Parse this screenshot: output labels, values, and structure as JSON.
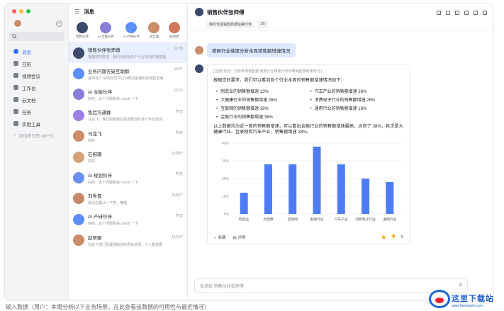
{
  "sidebar": {
    "search_icon": "search-icon",
    "items": [
      {
        "label": "消息",
        "active": true
      },
      {
        "label": "日历",
        "active": false
      },
      {
        "label": "视频会议",
        "active": false
      },
      {
        "label": "工作台",
        "active": false
      },
      {
        "label": "云文档",
        "active": false
      },
      {
        "label": "任务",
        "active": false
      },
      {
        "label": "实用工具",
        "active": false
      }
    ],
    "add_tab": "添加新页签 (⌘+T)"
  },
  "list": {
    "title": "消息",
    "ai_assistants": [
      {
        "label": "销售伙伴",
        "color": "#3b4a6b"
      },
      {
        "label": "AI 全能伙伴",
        "color": "#8a7fd8"
      },
      {
        "label": "AI 产研伙伴",
        "color": "#5b8ff9"
      },
      {
        "label": "赵云霞",
        "color": "#c98d6a"
      },
      {
        "label": "赵雨霏",
        "color": "#d07a5a"
      }
    ],
    "conversations": [
      {
        "name": "销售伙伴张师傅",
        "preview": "根据您的要求，我们对现有的个行业本周的销售额",
        "time": "10:35",
        "color": "#3b4a6b",
        "selected": true
      },
      {
        "name": "业务问题答疑互助群",
        "preview": "@所有人 请问你们可以对照这些组织的销售前端",
        "time": "10:21",
        "color": "#5b8ff9",
        "selected": false
      },
      {
        "name": "AI 全能伙伴",
        "preview": "好的，这个问题我来 check 一下",
        "time": "10:16",
        "color": "#8a7fd8",
        "selected": false
      },
      {
        "name": "售后沟通群",
        "preview": "马龙飞：我们的数据还是需要及时进行专业培训...",
        "time": "昨天",
        "color": "#9d7fe6",
        "selected": false
      },
      {
        "name": "马龙飞",
        "preview": "好的",
        "time": "昨天",
        "color": "#c98d6a",
        "selected": false
      },
      {
        "name": "石婉珊",
        "preview": "好的",
        "time": "10月27",
        "color": "#d6a079",
        "selected": false
      },
      {
        "name": "AI 规划伙伴",
        "preview": "好的，这个问题我来 check 一下",
        "time": "昨天",
        "color": "#6a8ff0",
        "selected": false
      },
      {
        "name": "刘秀晋",
        "preview": "我这边确认一下吧，哦哦",
        "time": "10月27",
        "color": "#c48a6c",
        "selected": false
      },
      {
        "name": "AI 产研伙伴",
        "preview": "好的，这个问题我来 check 一下",
        "time": "昨天",
        "color": "#5b8ff9",
        "selected": false
      },
      {
        "name": "赵翠娜",
        "preview": "在这个部门经理通知他的项目进展，个人帮进展",
        "time": "10月27",
        "color": "#c98d6a",
        "selected": false
      }
    ]
  },
  "chat": {
    "title": "销售伙伴张师傅",
    "chips": [
      "我的专属销售数据监察伙伴",
      "1/5"
    ],
    "user_message": "按照行业维度分析本周销售额增速情况",
    "reply": {
      "source": "[ 回复 张旭：分析本周销售额 按照行业维度分析本周销售额增速情况 ]",
      "intro": "根据您的要求，我们可以看到各个行业本周的销售额增速情况如下：",
      "bullets": [
        "制造业的销售额增速 13%",
        "汽车产业的销售额增速 28%",
        "大健康行业的销售额增速 26%",
        "消费电子行业的销售额增速 26%",
        "互联网的销售额增速 28%",
        "通用行业的销售额增速 18%",
        "金融行业的销售额增速 38%"
      ],
      "summary": "以上数据均为近一周的销售额增速，可以看出金融行业的销售额增速最高，达到了 38%，其次是大健康行业、互联网和汽车产业，销售额增速 28%。",
      "actions": {
        "like": "收藏",
        "detail": "详情"
      }
    },
    "input_placeholder": "发送给 销售伙伴张师傅"
  },
  "chart_data": {
    "type": "bar",
    "categories": [
      "制造业",
      "大健康",
      "互联网",
      "金融行业",
      "汽车产业",
      "消费电子行业",
      "通用行业"
    ],
    "values": [
      12,
      28,
      28,
      38,
      28,
      20,
      18
    ],
    "ylim": [
      0,
      40
    ],
    "yticks": [
      "0%",
      "10%",
      "20%",
      "30%",
      "40%"
    ],
    "bar_color": "#4e7cf6",
    "grid": true,
    "title": "",
    "xlabel": "",
    "ylabel": ""
  },
  "watermark": {
    "title": "这里下载站",
    "url": "www.heredown.com"
  },
  "footer_text": "输入数据（用户：本周分析以下业务场景，在此查看该数据的可用性与最近情况）"
}
